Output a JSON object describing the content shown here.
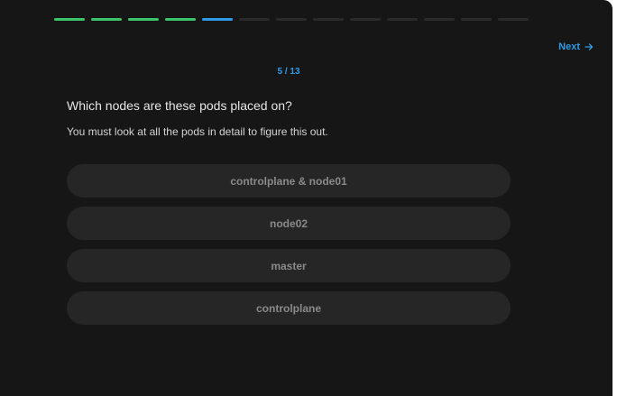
{
  "progress": {
    "total": 13,
    "completed": 4,
    "current": 5
  },
  "nav": {
    "next_label": "Next",
    "next_icon": "arrow-right-icon"
  },
  "counter": "5 / 13",
  "question": "Which nodes are these pods placed on?",
  "hint": "You must look at all the pods in detail to figure this out.",
  "options": [
    {
      "label": "controlplane & node01"
    },
    {
      "label": "node02"
    },
    {
      "label": "master"
    },
    {
      "label": "controlplane"
    }
  ],
  "colors": {
    "done": "#3cc46a",
    "current": "#2f9be6",
    "pending": "#2a2a2a",
    "background": "#161616"
  }
}
